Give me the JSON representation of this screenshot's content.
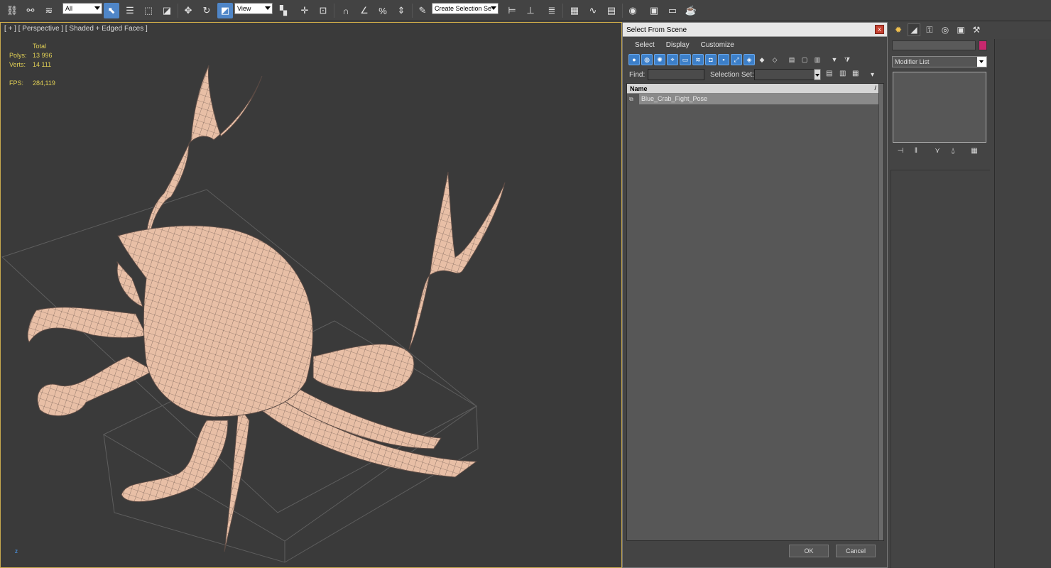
{
  "toolbar": {
    "filter_select": "All",
    "ref_coord": "View",
    "named_selection": "Create Selection Se",
    "icons": [
      "link-icon",
      "unlink-icon",
      "bind-spacewarp-icon",
      "select-object-icon",
      "select-by-name-icon",
      "rect-region-icon",
      "window-crossing-icon",
      "move-icon",
      "rotate-icon",
      "scale-icon",
      "select-manipulate-icon",
      "keyboard-shortcut-icon",
      "snaps-toggle-icon",
      "angle-snap-icon",
      "percent-snap-icon",
      "spinner-snap-icon",
      "edit-named-sel-icon",
      "mirror-icon",
      "align-icon",
      "layer-manager-icon",
      "scene-explorer-icon",
      "curve-editor-icon",
      "schematic-view-icon",
      "material-editor-icon",
      "render-setup-icon",
      "rendered-frame-icon",
      "render-icon"
    ]
  },
  "viewport": {
    "label": "[ + ] [ Perspective ] [ Shaded + Edged Faces ]",
    "stats": {
      "header": "Total",
      "polys_label": "Polys:",
      "polys_value": "13 996",
      "verts_label": "Verts:",
      "verts_value": "14 111",
      "fps_label": "FPS:",
      "fps_value": "284,119"
    },
    "axis_z": "z",
    "mesh_color": "#e8bfa6",
    "wire_color": "#5a4a44"
  },
  "dialog": {
    "title": "Select From Scene",
    "close": "x",
    "menu": [
      "Select",
      "Display",
      "Customize"
    ],
    "find_label": "Find:",
    "selection_set_label": "Selection Set:",
    "column_name": "Name",
    "sort_glyph": "/",
    "rows": [
      {
        "name": "Blue_Crab_Fight_Pose",
        "icon": "node-icon"
      }
    ],
    "ok": "OK",
    "cancel": "Cancel"
  },
  "command_panel": {
    "modifier_list": "Modifier List",
    "object_color": "#c8286e",
    "tabs": [
      "create-icon",
      "modify-icon",
      "hierarchy-icon",
      "motion-icon",
      "display-icon",
      "utilities-icon"
    ]
  }
}
